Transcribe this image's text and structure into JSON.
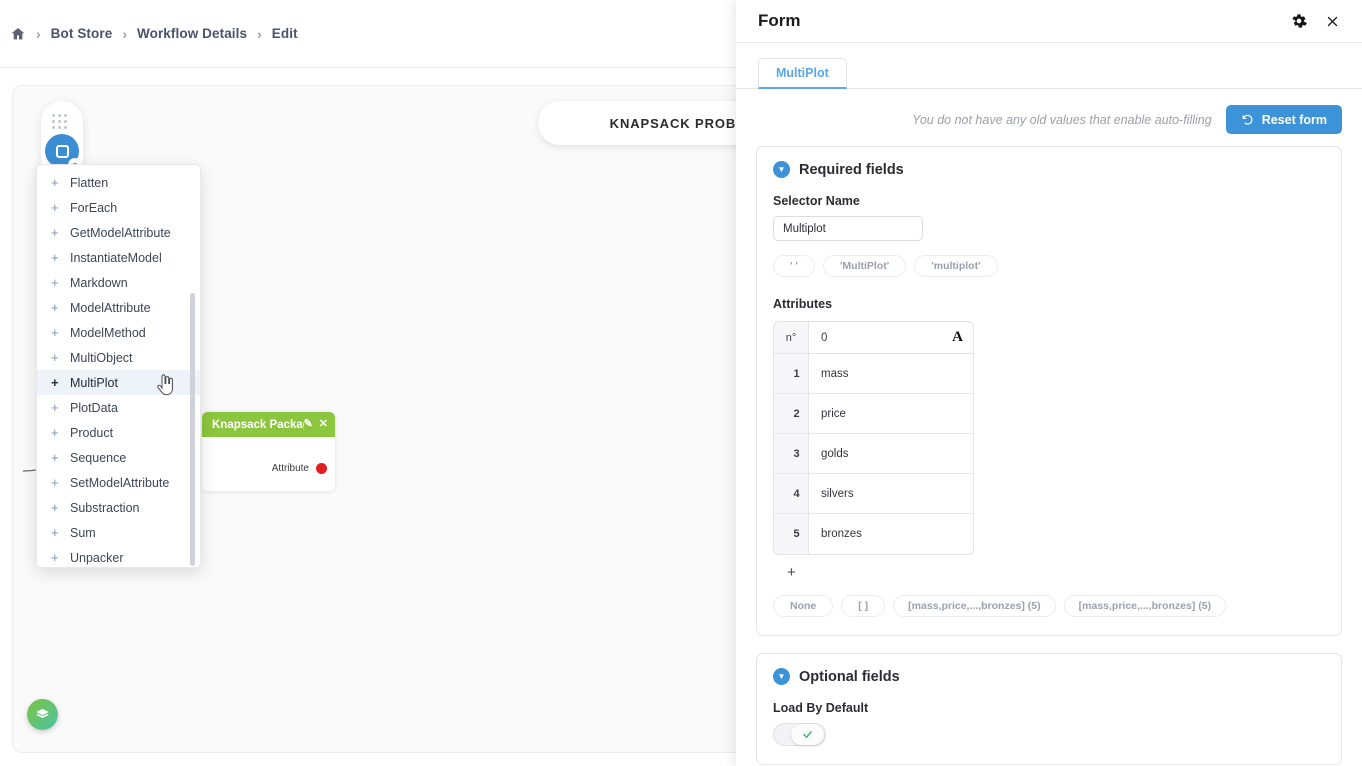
{
  "breadcrumb": {
    "home_icon": "home-icon",
    "items": [
      "Bot Store",
      "Workflow Details",
      "Edit"
    ],
    "separator": "›"
  },
  "canvas": {
    "title": "KNAPSACK PROBLEM",
    "palette_button_icon": "square-node-icon",
    "drag_handle_icon": "drag-dots-icon",
    "caret_icon": "chevron-down-icon",
    "fab_icon": "layers-icon",
    "node": {
      "title": "Knapsack Packages",
      "edit_icon": "external-edit-icon",
      "close_icon": "close-icon",
      "port_label": "Attribute",
      "port_color": "#e02020",
      "header_color": "#8cc63f"
    }
  },
  "menu": {
    "active_item": "MultiPlot",
    "add_icon": "plus-icon",
    "cursor_icon": "pointer-hand-icon",
    "items": [
      "Flatten",
      "ForEach",
      "GetModelAttribute",
      "InstantiateModel",
      "Markdown",
      "ModelAttribute",
      "ModelMethod",
      "MultiObject",
      "MultiPlot",
      "PlotData",
      "Product",
      "Sequence",
      "SetModelAttribute",
      "Substraction",
      "Sum",
      "Unpacker"
    ]
  },
  "panel": {
    "title": "Form",
    "gear_icon": "gear-icon",
    "close_icon": "close-icon",
    "tabs": [
      {
        "label": "MultiPlot",
        "active": true
      }
    ],
    "autofill_note": "You do not have any old values that enable auto-filling",
    "reset_button": {
      "label": "Reset form",
      "icon": "undo-icon"
    },
    "required_section": {
      "title": "Required fields",
      "chevron_icon": "chevron-down-circle-icon",
      "selector_name": {
        "label": "Selector Name",
        "value": "Multiplot",
        "placeholder": "",
        "suggestions": [
          "' '",
          "'MultiPlot'",
          "'multiplot'"
        ]
      },
      "attributes": {
        "label": "Attributes",
        "columns": [
          "n°",
          "0"
        ],
        "type_icon": "A",
        "rows": [
          {
            "n": "1",
            "value": "mass"
          },
          {
            "n": "2",
            "value": "price"
          },
          {
            "n": "3",
            "value": "golds"
          },
          {
            "n": "4",
            "value": "silvers"
          },
          {
            "n": "5",
            "value": "bronzes"
          }
        ],
        "add_icon": "plus-icon",
        "suggestions": [
          "None",
          "[ ]",
          "[mass,price,...,bronzes] (5)",
          "[mass,price,...,bronzes] (5)"
        ]
      }
    },
    "optional_section": {
      "title": "Optional fields",
      "chevron_icon": "chevron-down-circle-icon",
      "load_by_default": {
        "label": "Load By Default",
        "checked": true,
        "check_icon": "check-icon"
      }
    }
  },
  "colors": {
    "accent": "#3c93d8",
    "tab_blue": "#5ba7e8",
    "node_green": "#8cc63f",
    "port_red": "#e02020"
  }
}
